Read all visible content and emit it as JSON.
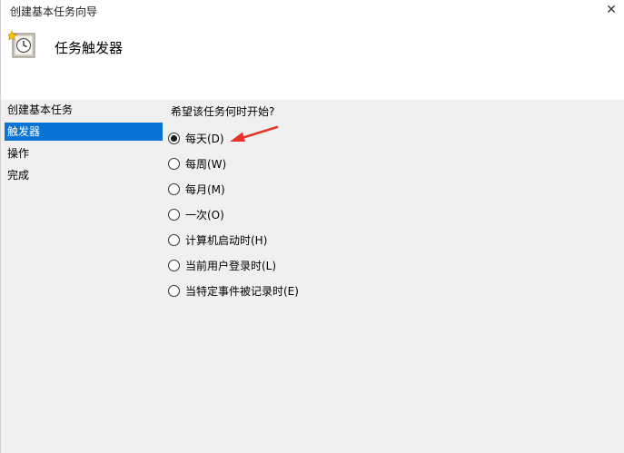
{
  "window": {
    "title": "创建基本任务向导",
    "close_glyph": "✕"
  },
  "header": {
    "title": "任务触发器",
    "icon": "task-scheduler-clock-icon"
  },
  "sidebar": {
    "items": [
      {
        "label": "创建基本任务",
        "active": false
      },
      {
        "label": "触发器",
        "active": true
      },
      {
        "label": "操作",
        "active": false
      },
      {
        "label": "完成",
        "active": false
      }
    ]
  },
  "main": {
    "question": "希望该任务何时开始?",
    "options": [
      {
        "label": "每天(D)",
        "selected": true
      },
      {
        "label": "每周(W)",
        "selected": false
      },
      {
        "label": "每月(M)",
        "selected": false
      },
      {
        "label": "一次(O)",
        "selected": false
      },
      {
        "label": "计算机启动时(H)",
        "selected": false
      },
      {
        "label": "当前用户登录时(L)",
        "selected": false
      },
      {
        "label": "当特定事件被记录时(E)",
        "selected": false
      }
    ]
  },
  "colors": {
    "selection": "#0a74d6",
    "panel": "#f0f0f0",
    "annotation_arrow": "#e8352b"
  }
}
